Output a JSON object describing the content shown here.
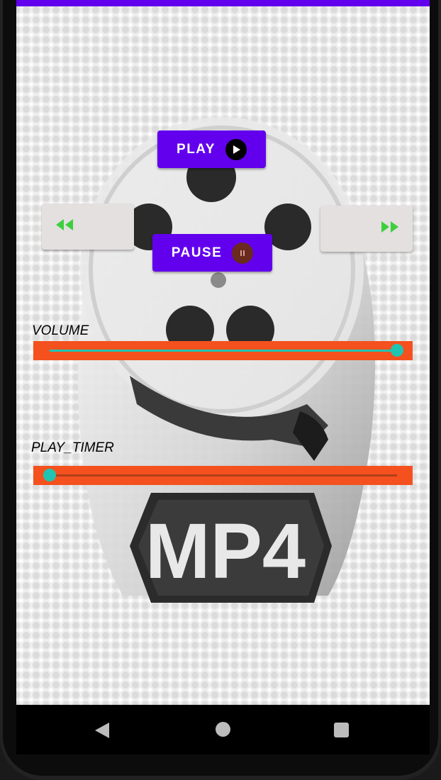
{
  "buttons": {
    "play_label": "PLAY",
    "pause_label": "PAUSE"
  },
  "seekbars": {
    "volume_label": "VOLUME",
    "volume_value": 1.0,
    "timer_label": "PLAY_TIMER",
    "timer_value": 0.0
  },
  "background": {
    "logo_text": "MP4"
  },
  "icons": {
    "rewind": "rewind-icon",
    "fast_forward": "fast-forward-icon",
    "play": "play-icon",
    "pause": "pause-icon",
    "nav_back": "back-icon",
    "nav_home": "home-icon",
    "nav_recent": "recents-icon"
  },
  "colors": {
    "primary": "#6200ee",
    "seekbar_background": "#f4511e",
    "seekbar_accent": "#1fc5b2",
    "media_icon_green": "#3ecf3e"
  }
}
